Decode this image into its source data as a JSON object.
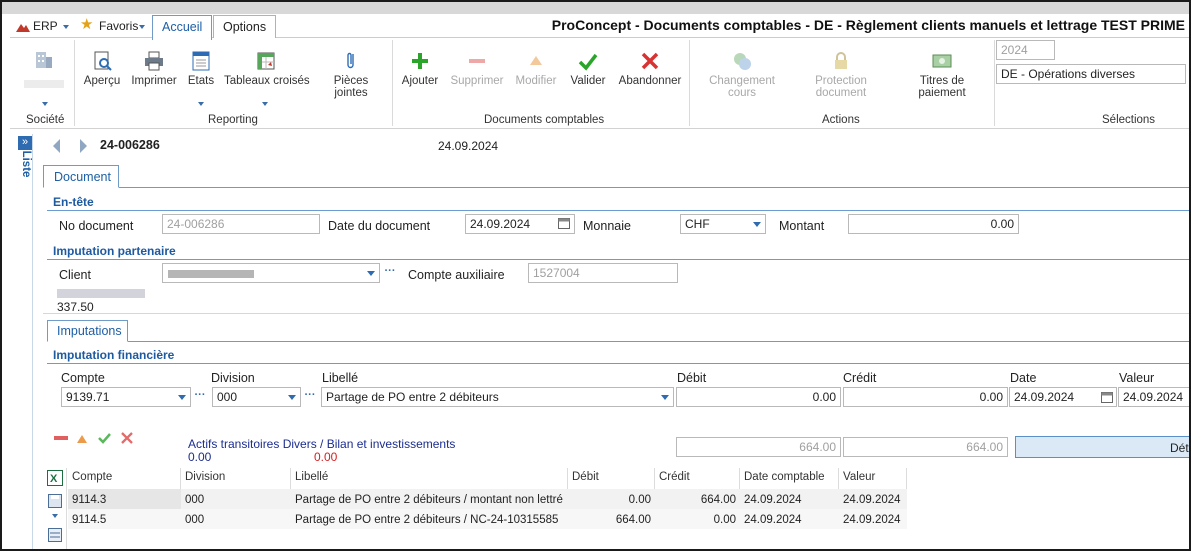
{
  "ribbon_tabs": {
    "erp": "ERP",
    "favoris": "Favoris",
    "accueil": "Accueil",
    "options": "Options"
  },
  "window_title": "ProConcept - Documents comptables - DE - Règlement clients manuels et lettrage TEST PRIME",
  "ribbon": {
    "societe": "Société",
    "apercu": "Aperçu",
    "imprimer": "Imprimer",
    "etats": "Etats",
    "tableaux_croises": "Tableaux croisés",
    "pieces_jointes_1": "Pièces",
    "pieces_jointes_2": "jointes",
    "reporting": "Reporting",
    "ajouter": "Ajouter",
    "supprimer": "Supprimer",
    "modifier": "Modifier",
    "valider": "Valider",
    "abandonner": "Abandonner",
    "documents_comptables": "Documents comptables",
    "changement_cours_1": "Changement",
    "changement_cours_2": "cours",
    "protection_document_1": "Protection",
    "protection_document_2": "document",
    "titres_paiement_1": "Titres de",
    "titres_paiement_2": "paiement",
    "actions": "Actions",
    "year": "2024",
    "journal": "DE - Opérations diverses",
    "selections": "Sélections"
  },
  "side_panel": {
    "liste": "Liste"
  },
  "nav": {
    "doc_number": "24-006286",
    "doc_date": "24.09.2024"
  },
  "doc_tab": "Document",
  "entete": {
    "title": "En-tête",
    "no_document_label": "No document",
    "no_document_value": "24-006286",
    "date_label": "Date du document",
    "date_value": "24.09.2024",
    "monnaie_label": "Monnaie",
    "monnaie_value": "CHF",
    "montant_label": "Montant",
    "montant_value": "0.00"
  },
  "partenaire": {
    "title": "Imputation partenaire",
    "client_label": "Client",
    "compte_aux_label": "Compte auxiliaire",
    "compte_aux_value": "1527004",
    "balance": "337.50"
  },
  "imputations_tab": "Imputations",
  "financiere": {
    "title": "Imputation financière",
    "headers": {
      "compte": "Compte",
      "division": "Division",
      "libelle": "Libellé",
      "debit": "Débit",
      "credit": "Crédit",
      "date": "Date",
      "valeur": "Valeur"
    },
    "compte": "9139.71",
    "division": "000",
    "libelle": "Partage de PO entre 2 débiteurs",
    "debit": "0.00",
    "credit": "0.00",
    "date": "24.09.2024",
    "valeur": "24.09.2024",
    "account_desc": "Actifs transitoires Divers / Bilan et investissements",
    "total_blue": "0.00",
    "total_red": "0.00",
    "sum_debit": "664.00",
    "sum_credit": "664.00",
    "detail_button": "Déta"
  },
  "grid": {
    "headers": [
      "Compte",
      "Division",
      "Libellé",
      "Débit",
      "Crédit",
      "Date comptable",
      "Valeur"
    ],
    "rows": [
      {
        "compte": "9114.3",
        "division": "000",
        "libelle": "Partage de PO entre 2 débiteurs / montant non lettré",
        "debit": "0.00",
        "credit": "664.00",
        "date": "24.09.2024",
        "valeur": "24.09.2024"
      },
      {
        "compte": "9114.5",
        "division": "000",
        "libelle": "Partage de PO entre 2 débiteurs / NC-24-10315585",
        "debit": "664.00",
        "credit": "0.00",
        "date": "24.09.2024",
        "valeur": "24.09.2024"
      }
    ]
  },
  "colors": {
    "accent": "#1e5fa5",
    "add": "#2aa52a",
    "delete": "#e06060",
    "validate": "#2aa52a",
    "cancel": "#d83232",
    "selected_row": "#e6e6e6"
  }
}
